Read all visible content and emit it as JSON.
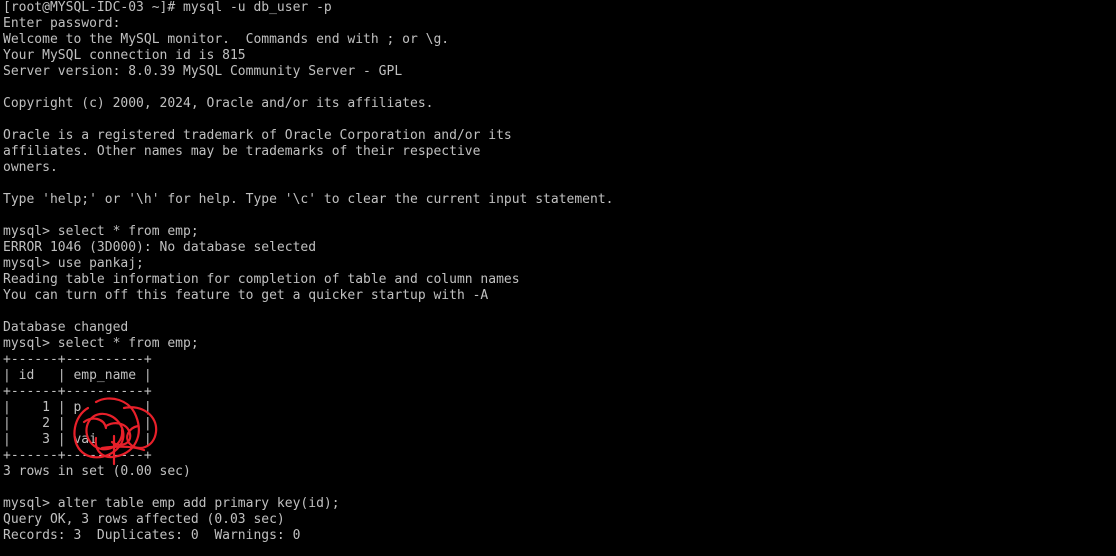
{
  "terminal": {
    "lines": [
      "[root@MYSQL-IDC-03 ~]# mysql -u db_user -p",
      "Enter password:",
      "Welcome to the MySQL monitor.  Commands end with ; or \\g.",
      "Your MySQL connection id is 815",
      "Server version: 8.0.39 MySQL Community Server - GPL",
      "",
      "Copyright (c) 2000, 2024, Oracle and/or its affiliates.",
      "",
      "Oracle is a registered trademark of Oracle Corporation and/or its",
      "affiliates. Other names may be trademarks of their respective",
      "owners.",
      "",
      "Type 'help;' or '\\h' for help. Type '\\c' to clear the current input statement.",
      "",
      "mysql> select * from emp;",
      "ERROR 1046 (3D000): No database selected",
      "mysql> use pankaj;",
      "Reading table information for completion of table and column names",
      "You can turn off this feature to get a quicker startup with -A",
      "",
      "Database changed",
      "mysql> select * from emp;",
      "+------+----------+",
      "| id   | emp_name |",
      "+------+----------+",
      "|    1 | p        |",
      "|    2 |          |",
      "|    3 | vai      |",
      "+------+----------+",
      "3 rows in set (0.00 sec)",
      "",
      "mysql> alter table emp add primary key(id);",
      "Query OK, 3 rows affected (0.03 sec)",
      "Records: 3  Duplicates: 0  Warnings: 0"
    ]
  },
  "colors": {
    "background": "#000000",
    "text": "#c0c0c0",
    "redaction": "#e8202a"
  }
}
